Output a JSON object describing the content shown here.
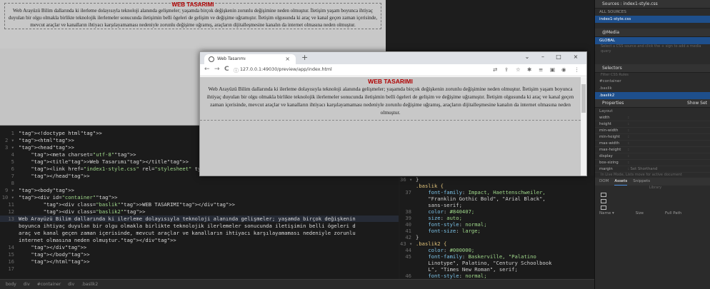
{
  "page": {
    "heading": "WEB TASARIMI",
    "paragraph": "Web Arayüzü Bilim dallarında ki ilerleme dolayısıyla teknoloji alanında gelişmeler; yaşamda birçok değişkenin zorunlu değişimine neden olmuştur. İletişim yaşam boyunca ihtiyaç duyulan bir olgu olmakla birlikte teknolojik ilerlemeler sonucunda iletişimin belli ögeleri de gelişim ve değişime uğramıştır. İletişim olgusunda ki araç ve kanal geçen zaman içerisinde, mevcut araçlar ve kanalların ihtiyacı karşılayamaması nedeniyle zorunlu değişime uğramış, araçların dijitalleşmesine kanalın da internet olmasına neden olmuştur."
  },
  "browser": {
    "tab_title": "Web Tasarımı",
    "tab_close": "×",
    "new_tab": "+",
    "url": "127.0.0.1:49030/preview/app/index.html",
    "nav_back": "←",
    "nav_forward": "→",
    "reload": "C",
    "info": "ⓘ",
    "min": "–",
    "max": "□",
    "close": "×",
    "chevron": "⌄"
  },
  "code_lines": [
    {
      "n": "1",
      "t": "<!doctype html>"
    },
    {
      "n": "2 ▾",
      "t": "<html>"
    },
    {
      "n": "3 ▾",
      "t": "<head>"
    },
    {
      "n": "4",
      "t": "    <meta charset=\"utf-8\">"
    },
    {
      "n": "5",
      "t": "    <title>Web Tasarımı</title>"
    },
    {
      "n": "6",
      "t": "    <link href=\"index1-style.css\" rel=\"stylesheet\" ty"
    },
    {
      "n": "7",
      "t": "    </head>"
    },
    {
      "n": "8",
      "t": ""
    },
    {
      "n": "9 ▾",
      "t": "<body>"
    },
    {
      "n": "10 ▾",
      "t": "<div id=\"container\">"
    },
    {
      "n": "11",
      "t": "        <div class=\"baslik\">WEB TASARIMI</div>"
    },
    {
      "n": "12",
      "t": "        <div class=\"baslik2\">"
    },
    {
      "n": "13",
      "t": "Web Arayüzü Bilim dallarında ki ilerleme dolayısıyla teknoloji alanında gelişmeler; yaşamda birçok değişkenin"
    },
    {
      "n": "",
      "t": "boyunca ihtiyaç duyulan bir olgu olmakla birlikte teknolojik ilerlemeler sonucunda iletişimin belli ögeleri d"
    },
    {
      "n": "",
      "t": "araç ve kanal geçen zaman içerisinde, mevcut araçlar ve kanalların ihtiyacı karşılayamaması nedeniyle zorunlu"
    },
    {
      "n": "",
      "t": "internet olmasına neden olmuştur.</div>"
    },
    {
      "n": "14",
      "t": "    </div>"
    },
    {
      "n": "15",
      "t": "    </body>"
    },
    {
      "n": "16",
      "t": "    </html>"
    },
    {
      "n": "17",
      "t": ""
    }
  ],
  "css_lines": [
    {
      "n": "36 ▾",
      "t": "}"
    },
    {
      "n": "",
      "t": ".baslik {"
    },
    {
      "n": "37",
      "t": "    font-family: Impact, Haettenschweiler,"
    },
    {
      "n": "",
      "t": "    \"Franklin Gothic Bold\", \"Arial Black\","
    },
    {
      "n": "",
      "t": "    sans-serif;"
    },
    {
      "n": "38",
      "t": "    color: #840407;"
    },
    {
      "n": "39",
      "t": "    size: auto;"
    },
    {
      "n": "40",
      "t": "    font-style: normal;"
    },
    {
      "n": "41",
      "t": "    font-size: large;"
    },
    {
      "n": "42",
      "t": "}"
    },
    {
      "n": "43 ▾",
      "t": ".baslik2 {"
    },
    {
      "n": "44",
      "t": "    color: #000000;"
    },
    {
      "n": "45",
      "t": "    font-family: Baskerville, \"Palatino"
    },
    {
      "n": "",
      "t": "    Linotype\", Palatino, \"Century Schoolbook"
    },
    {
      "n": "",
      "t": "    L\", \"Times New Roman\", serif;"
    },
    {
      "n": "46",
      "t": "    font-style: normal;"
    }
  ],
  "status": [
    "body",
    "div",
    "#container",
    "div",
    ".baslik2"
  ],
  "right_panel": {
    "sources_head": "Sources : index1-style.css",
    "all_sources": "ALL SOURCES",
    "source_item": "index1-style.css",
    "media_head": "@Media",
    "global": "GLOBAL",
    "media_hint": "Select a CSS source and click the + sign to add a media query",
    "selectors_head": "Selectors",
    "filter": "Filter CSS Rules",
    "selectors": [
      "#container",
      ".baslik",
      ".baslik2"
    ],
    "properties_head": "Properties",
    "show_set": "Show Set",
    "layout": "Layout",
    "props": [
      {
        "k": "width",
        "v": ":"
      },
      {
        "k": "height",
        "v": ":"
      },
      {
        "k": "min-width",
        "v": ":"
      },
      {
        "k": "min-height",
        "v": ":"
      },
      {
        "k": "max-width",
        "v": ":"
      },
      {
        "k": "max-height",
        "v": ":"
      },
      {
        "k": "display",
        "v": ":"
      },
      {
        "k": "box-sizing",
        "v": ":"
      },
      {
        "k": "margin",
        "v": ":   Set Shorthand"
      }
    ],
    "live_note": "In Live Mode, Lists move for active document",
    "tabs": [
      "DOM",
      "Assets",
      "Snippets"
    ],
    "active_tab": "Assets",
    "library": "Library",
    "footer_cols": [
      "Name ▾",
      "Size",
      "Full Path"
    ]
  }
}
